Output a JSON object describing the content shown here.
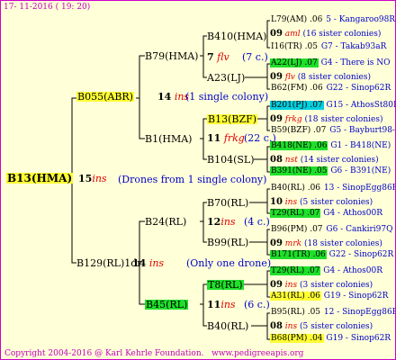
{
  "date": "17- 11-2016 ( 19: 20)",
  "root": {
    "name": "B13(HMA)",
    "count": "15",
    "note": "(Drones from 1 single colony)"
  },
  "gen1": [
    {
      "name": "B055(ABR)",
      "count": "14",
      "note": "(1 single colony)"
    },
    {
      "name": "B129(RL)1dr",
      "count": "14",
      "note": "(Only one drone)"
    }
  ],
  "gen2": [
    {
      "name": "B79(HMA)"
    },
    {
      "name": "B1(HMA)",
      "count": "11",
      "ins": "frkg",
      "note": "(22 c.)"
    },
    {
      "name": "B24(RL)",
      "count": "12",
      "note": "(4 c.)"
    },
    {
      "name": "B45(RL)",
      "count": "11",
      "note": "(6 c.)"
    }
  ],
  "gen3": [
    {
      "name": "B410(HMA)"
    },
    {
      "name": "A23(LJ)"
    },
    {
      "name": "B13(BZF)"
    },
    {
      "name": "B104(SL)"
    },
    {
      "name": "B70(RL)"
    },
    {
      "name": "B99(RL)"
    },
    {
      "name": "T8(RL)"
    },
    {
      "name": "B40(RL)"
    }
  ],
  "gen3_sub": [
    {
      "count": "7",
      "ins": "flv",
      "note": "(7 c.)"
    }
  ],
  "gen4": [
    {
      "id": "L79(AM) .06",
      "tail": "5 - Kangaroo98R"
    },
    {
      "count": "09",
      "ins": "aml",
      "note": "(16 sister colonies)"
    },
    {
      "id": "I16(TR) .05",
      "tail": "G7 - Takab93aR"
    },
    {
      "id": "A22(LJ) .07",
      "tail": "G4 - There is NO"
    },
    {
      "count": "09",
      "ins": "flv",
      "note": "(8 sister colonies)"
    },
    {
      "id": "B62(FM) .06",
      "tail": "G22 - Sinop62R"
    },
    {
      "id": "B201(PJ) .07",
      "tail": "G15 - AthosSt80R"
    },
    {
      "count": "09",
      "ins": "frkg",
      "note": "(18 sister colonies)"
    },
    {
      "id": "B59(BZF) .07",
      "tail": "G5 - Bayburt98-3"
    },
    {
      "id": "B418(NE) .06",
      "tail": "G1 - B418(NE)"
    },
    {
      "count": "08",
      "ins": "nst",
      "note": "(14 sister colonies)"
    },
    {
      "id": "B391(NE) .05",
      "tail": "G6 - B391(NE)"
    },
    {
      "id": "B40(RL) .06",
      "tail": "13 - SinopEgg86R"
    },
    {
      "count": "10",
      "ins": "ins",
      "note": "(5 sister colonies)"
    },
    {
      "id": "T29(RL) .07",
      "tail": "G4 - Athos00R"
    },
    {
      "id": "B96(PM) .07",
      "tail": "G6 - Cankiri97Q"
    },
    {
      "count": "09",
      "ins": "mrk",
      "note": "(18 sister colonies)"
    },
    {
      "id": "B171(TR) .06",
      "tail": "G22 - Sinop62R"
    },
    {
      "id": "T29(RL) .07",
      "tail": "G4 - Athos00R"
    },
    {
      "count": "09",
      "ins": "ins",
      "note": "(3 sister colonies)"
    },
    {
      "id": "A31(RL) .06",
      "tail": "G19 - Sinop62R"
    },
    {
      "id": "B95(RL) .05",
      "tail": "12 - SinopEgg86R"
    },
    {
      "count": "08",
      "ins": "ins",
      "note": "(5 sister colonies)"
    },
    {
      "id": "B68(PM) .04",
      "tail": "G19 - Sinop62R"
    }
  ],
  "ins_word": "ins",
  "footer": {
    "copyright": "Copyright 2004-2016 @ Karl Kehrle Foundation.",
    "site": "www.pedigreeapis.org"
  },
  "colors": {
    "frame": "#cc00cc",
    "background": "#ffffd8",
    "yellow": "#ffff33",
    "green": "#1ee02a",
    "cyan": "#00d0e0",
    "magenta": "#c000c0",
    "red": "#e00000",
    "blue": "#0000cc"
  }
}
